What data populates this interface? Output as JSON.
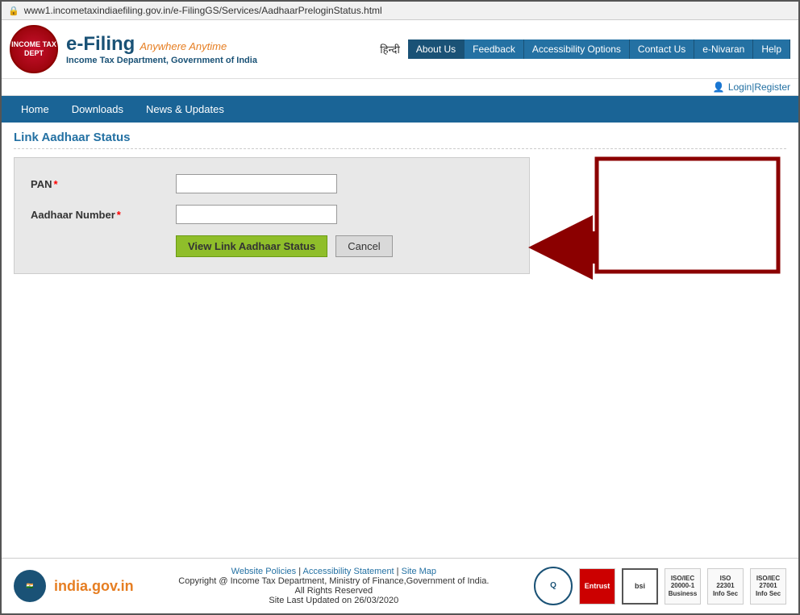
{
  "browser": {
    "url": "www1.incometaxindiaefiling.gov.in/e-FilingGS/Services/AadhaarPreloginStatus.html"
  },
  "header": {
    "logo_text": "INCOME TAX DEPT",
    "site_name": "e-Filing",
    "anywhere_anytime": "Anywhere Anytime",
    "dept_name": "Income Tax Department, Government of India",
    "hindi_label": "हिन्दी",
    "nav_items": [
      {
        "label": "About Us",
        "active": true
      },
      {
        "label": "Feedback"
      },
      {
        "label": "Accessibility Options"
      },
      {
        "label": "Contact Us"
      },
      {
        "label": "e-Nivaran"
      },
      {
        "label": "Help"
      }
    ],
    "login_label": "Login",
    "register_label": "Register"
  },
  "main_nav": {
    "items": [
      {
        "label": "Home"
      },
      {
        "label": "Downloads"
      },
      {
        "label": "News & Updates"
      }
    ]
  },
  "page": {
    "section_title": "Link Aadhaar Status",
    "form": {
      "pan_label": "PAN",
      "aadhaar_label": "Aadhaar Number",
      "view_button": "View Link Aadhaar Status",
      "cancel_button": "Cancel"
    }
  },
  "footer": {
    "india_gov": "india.gov.in",
    "links": [
      "Website Policies",
      "Accessibility Statement",
      "Site Map"
    ],
    "copyright": "Copyright @ Income Tax Department, Ministry of Finance,Government of India.",
    "rights": "All Rights Reserved",
    "last_updated": "Site Last Updated on 26/03/2020",
    "badges": [
      {
        "label": "ISO/IEC\n20000-1\nBusiness\nSecurity"
      },
      {
        "label": "ISO\n22301\nInformation\nSecurity"
      },
      {
        "label": "ISO/IEC\n27001\nInformation\nSecurity"
      }
    ]
  }
}
